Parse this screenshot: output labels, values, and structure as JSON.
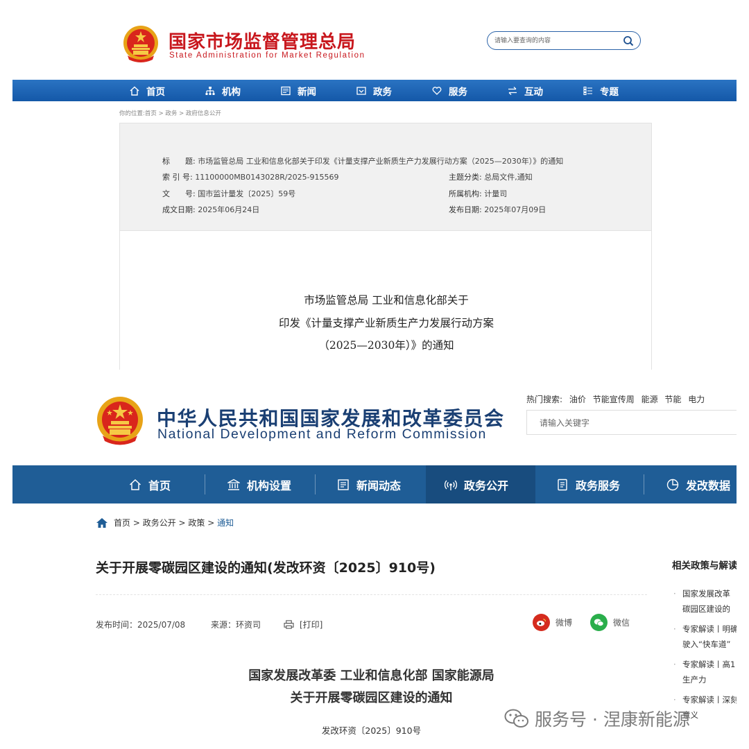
{
  "samr": {
    "site_title": "国家市场监督管理总局",
    "site_subtitle": "State Administration for Market Regulation",
    "search_placeholder": "请输入要查询的内容",
    "nav": [
      {
        "label": "首页",
        "icon": "home-icon"
      },
      {
        "label": "机构",
        "icon": "org-icon"
      },
      {
        "label": "新闻",
        "icon": "news-icon"
      },
      {
        "label": "政务",
        "icon": "gov-icon"
      },
      {
        "label": "服务",
        "icon": "heart-icon"
      },
      {
        "label": "互动",
        "icon": "exchange-icon"
      },
      {
        "label": "专题",
        "icon": "topic-icon"
      }
    ],
    "breadcrumb": "你的位置:首页 > 政务 > 政府信息公开",
    "meta": {
      "title_label": "标　　题:",
      "title_value": "市场监管总局 工业和信息化部关于印发《计量支撑产业新质生产力发展行动方案（2025—2030年）》的通知",
      "index_label": "索 引 号:",
      "index_value": "11100000MB0143028R/2025-915569",
      "category_label": "主题分类:",
      "category_value": "总局文件,通知",
      "docno_label": "文　　号:",
      "docno_value": "国市监计量发〔2025〕59号",
      "org_label": "所属机构:",
      "org_value": "计量司",
      "date_label": "成文日期:",
      "date_value": "2025年06月24日",
      "publish_label": "发布日期:",
      "publish_value": "2025年07月09日"
    },
    "doc_title": [
      "市场监管总局 工业和信息化部关于",
      "印发《计量支撑产业新质生产力发展行动方案",
      "（2025—2030年）》的通知"
    ]
  },
  "ndrc": {
    "site_title": "中华人民共和国国家发展和改革委员会",
    "site_subtitle": "National Development and Reform Commission",
    "hot_label": "热门搜索:",
    "hot_terms": [
      "油价",
      "节能宣传周",
      "能源",
      "节能",
      "电力"
    ],
    "search_placeholder": "请输入关键字",
    "nav": [
      {
        "label": "首页",
        "icon": "home-icon"
      },
      {
        "label": "机构设置",
        "icon": "building-icon"
      },
      {
        "label": "新闻动态",
        "icon": "newspaper-icon"
      },
      {
        "label": "政务公开",
        "icon": "broadcast-icon"
      },
      {
        "label": "政务服务",
        "icon": "document-icon"
      },
      {
        "label": "发改数据",
        "icon": "pie-chart-icon"
      }
    ],
    "breadcrumb": [
      "首页",
      "政务公开",
      "政策",
      "通知"
    ],
    "page_title": "关于开展零碳园区建设的通知(发改环资〔2025〕910号)",
    "publish_time": "发布时间：2025/07/08",
    "source": "来源：环资司",
    "print_label": "[打印]",
    "share": [
      {
        "label": "微博",
        "icon": "weibo-icon",
        "color": "#d52b1e"
      },
      {
        "label": "微信",
        "icon": "wechat-icon",
        "color": "#2aae4b"
      }
    ],
    "body_title": [
      "国家发展改革委 工业和信息化部 国家能源局",
      "关于开展零碳园区建设的通知"
    ],
    "doc_number": "发改环资〔2025〕910号",
    "sidebar_heading": "相关政策与解读",
    "sidebar_items": [
      [
        "国家发展改革",
        "碳园区建设的"
      ],
      [
        "专家解读丨明确",
        "驶入“快车道”"
      ],
      [
        "专家解读丨高1",
        "生产力"
      ],
      [
        "专家解读丨深刻",
        "意义"
      ]
    ]
  },
  "watermark": "服务号 · 涅康新能源",
  "colors": {
    "samr_red": "#c8171d",
    "samr_nav_blue": "#1a62b2",
    "ndrc_blue": "#1a3f73",
    "ndrc_nav_blue": "#1f5d96"
  }
}
